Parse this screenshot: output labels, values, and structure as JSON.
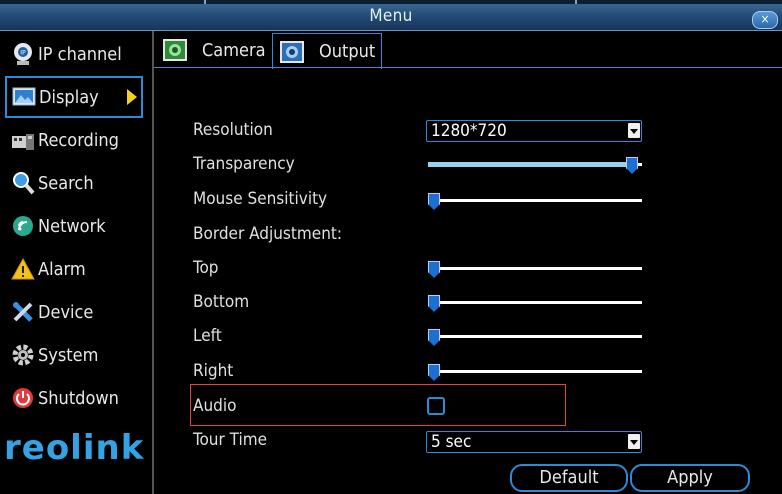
{
  "window": {
    "title": "Menu",
    "close_label": "×"
  },
  "sidebar": {
    "items": [
      {
        "label": "IP channel",
        "icon": "ip-channel-icon"
      },
      {
        "label": "Display",
        "icon": "display-icon",
        "active": true
      },
      {
        "label": "Recording",
        "icon": "recording-icon"
      },
      {
        "label": "Search",
        "icon": "search-icon"
      },
      {
        "label": "Network",
        "icon": "network-icon"
      },
      {
        "label": "Alarm",
        "icon": "alarm-icon"
      },
      {
        "label": "Device",
        "icon": "device-icon"
      },
      {
        "label": "System",
        "icon": "system-icon"
      },
      {
        "label": "Shutdown",
        "icon": "shutdown-icon"
      }
    ],
    "logo": "reolink"
  },
  "tabs": [
    {
      "label": "Camera",
      "icon": "camera-icon"
    },
    {
      "label": "Output",
      "icon": "output-icon",
      "active": true
    }
  ],
  "form": {
    "resolution": {
      "label": "Resolution",
      "value": "1280*720"
    },
    "transparency": {
      "label": "Transparency",
      "value_fraction": 0.97
    },
    "mouse_sensitivity": {
      "label": "Mouse Sensitivity",
      "value_fraction": 0.0
    },
    "border_adjustment": {
      "label": "Border Adjustment:"
    },
    "top": {
      "label": "Top",
      "value_fraction": 0.0
    },
    "bottom": {
      "label": "Bottom",
      "value_fraction": 0.0
    },
    "left": {
      "label": "Left",
      "value_fraction": 0.0
    },
    "right": {
      "label": "Right",
      "value_fraction": 0.0
    },
    "audio": {
      "label": "Audio",
      "checked": false
    },
    "tour_time": {
      "label": "Tour Time",
      "value": "5 sec"
    }
  },
  "buttons": {
    "default_label": "Default",
    "apply_label": "Apply"
  },
  "colors": {
    "accent": "#2d8ad6",
    "highlight": "#e34040",
    "logo": "#33a3e3"
  }
}
